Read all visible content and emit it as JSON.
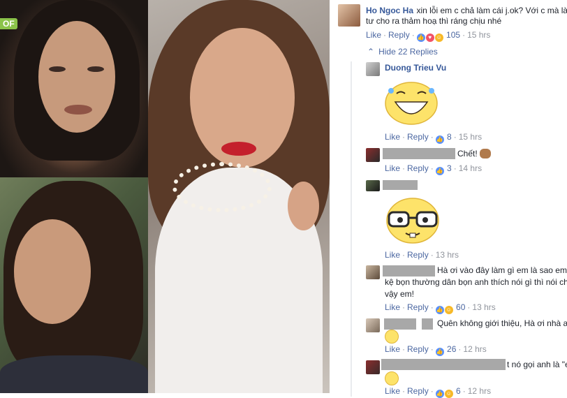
{
  "left_photos": {
    "logo_text": "OF"
  },
  "thread": {
    "main": {
      "author": "Ho Ngoc Ha",
      "text_line1": "xin lỗi em c chả làm cái j.ok? Với c mà làm",
      "text_line2": "tư cho ra thảm hoạ thì ráng chịu nhé",
      "like": "Like",
      "reply": "Reply",
      "count": "105",
      "time": "15 hrs"
    },
    "hide_replies": "Hide 22 Replies",
    "replies": [
      {
        "author": "Duong Trieu Vu",
        "like": "Like",
        "reply": "Reply",
        "count": "8",
        "time": "15 hrs"
      },
      {
        "text": "Chết!",
        "like": "Like",
        "reply": "Reply",
        "count": "3",
        "time": "14 hrs"
      },
      {
        "like": "Like",
        "reply": "Reply",
        "time": "13 hrs"
      },
      {
        "text_line1": "Hà ơi vào đây làm gì em là sao em",
        "text_line2": "kệ bọn thường dân bọn anh thích nói gì thì nói ch",
        "text_line3": "vậy em!",
        "like": "Like",
        "reply": "Reply",
        "count": "60",
        "time": "13 hrs"
      },
      {
        "text": "Quên không giới thiệu, Hà ơi nhà a",
        "like": "Like",
        "reply": "Reply",
        "count": "26",
        "time": "12 hrs"
      },
      {
        "text": "t nó gọi anh là \"e",
        "like": "Like",
        "reply": "Reply",
        "count": "6",
        "time": "12 hrs"
      }
    ]
  }
}
